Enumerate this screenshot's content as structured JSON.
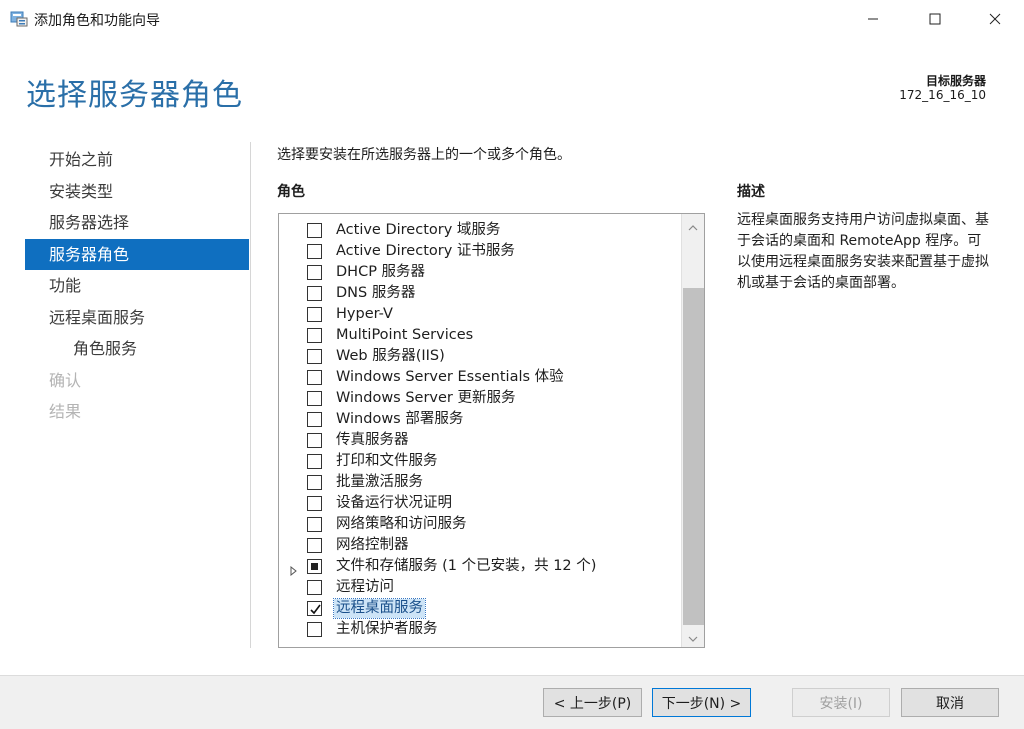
{
  "window": {
    "title": "添加角色和功能向导",
    "icons": {
      "app": "server-manager-icon",
      "minimize": "minimize-icon",
      "maximize": "maximize-icon",
      "close": "close-icon"
    }
  },
  "header": {
    "page_title": "选择服务器角色",
    "target_label": "目标服务器",
    "target_value": "172_16_16_10"
  },
  "nav": {
    "items": [
      {
        "label": "开始之前",
        "state": "normal"
      },
      {
        "label": "安装类型",
        "state": "normal"
      },
      {
        "label": "服务器选择",
        "state": "normal"
      },
      {
        "label": "服务器角色",
        "state": "active"
      },
      {
        "label": "功能",
        "state": "normal"
      },
      {
        "label": "远程桌面服务",
        "state": "normal"
      },
      {
        "label": "角色服务",
        "state": "sub"
      },
      {
        "label": "确认",
        "state": "disabled"
      },
      {
        "label": "结果",
        "state": "disabled"
      }
    ]
  },
  "main": {
    "instruction": "选择要安装在所选服务器上的一个或多个角色。",
    "roles_heading": "角色",
    "roles": [
      {
        "label": "Active Directory 域服务",
        "checked": "none"
      },
      {
        "label": "Active Directory 证书服务",
        "checked": "none"
      },
      {
        "label": "DHCP 服务器",
        "checked": "none"
      },
      {
        "label": "DNS 服务器",
        "checked": "none"
      },
      {
        "label": "Hyper-V",
        "checked": "none"
      },
      {
        "label": "MultiPoint Services",
        "checked": "none"
      },
      {
        "label": "Web 服务器(IIS)",
        "checked": "none"
      },
      {
        "label": "Windows Server Essentials 体验",
        "checked": "none"
      },
      {
        "label": "Windows Server 更新服务",
        "checked": "none"
      },
      {
        "label": "Windows 部署服务",
        "checked": "none"
      },
      {
        "label": "传真服务器",
        "checked": "none"
      },
      {
        "label": "打印和文件服务",
        "checked": "none"
      },
      {
        "label": "批量激活服务",
        "checked": "none"
      },
      {
        "label": "设备运行状况证明",
        "checked": "none"
      },
      {
        "label": "网络策略和访问服务",
        "checked": "none"
      },
      {
        "label": "网络控制器",
        "checked": "none"
      },
      {
        "label": "文件和存储服务 (1 个已安装，共 12 个)",
        "checked": "partial",
        "expandable": true
      },
      {
        "label": "远程访问",
        "checked": "none"
      },
      {
        "label": "远程桌面服务",
        "checked": "checked",
        "selected": true
      },
      {
        "label": "主机保护者服务",
        "checked": "none"
      }
    ],
    "description_heading": "描述",
    "description_text": "远程桌面服务支持用户访问虚拟桌面、基于会话的桌面和 RemoteApp 程序。可以使用远程桌面服务安装来配置基于虚拟机或基于会话的桌面部署。"
  },
  "footer": {
    "prev_label": "< 上一步(P)",
    "next_label": "下一步(N) >",
    "install_label": "安装(I)",
    "cancel_label": "取消"
  },
  "colors": {
    "accent": "#0f6fc0",
    "title": "#2a6fa8",
    "disabled": "#b4b4b4"
  }
}
